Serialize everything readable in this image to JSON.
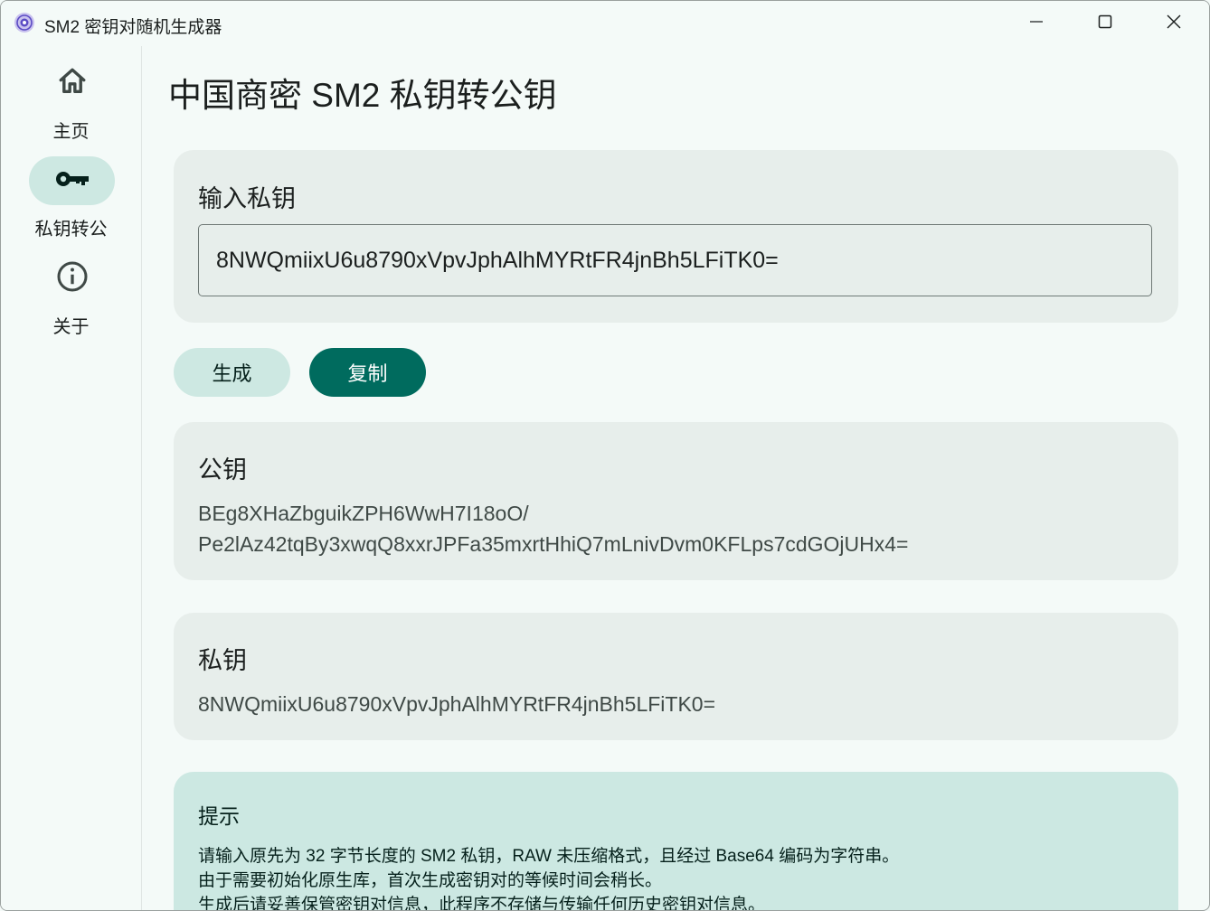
{
  "window": {
    "title": "SM2 密钥对随机生成器",
    "icons": {
      "app": "app-logo-icon",
      "minimize": "minimize-icon",
      "maximize": "maximize-icon",
      "close": "close-icon"
    }
  },
  "sidebar": {
    "items": [
      {
        "label": "主页",
        "icon": "home-icon",
        "active": false
      },
      {
        "label": "私钥转公",
        "icon": "key-icon",
        "active": true
      },
      {
        "label": "关于",
        "icon": "info-icon",
        "active": false
      }
    ]
  },
  "page": {
    "title": "中国商密 SM2 私钥转公钥"
  },
  "input_card": {
    "title": "输入私钥",
    "value": "8NWQmiixU6u8790xVpvJphAlhMYRtFR4jnBh5LFiTK0="
  },
  "actions": {
    "generate_label": "生成",
    "copy_label": "复制"
  },
  "public_key_card": {
    "title": "公钥",
    "value_line1": "BEg8XHaZbguikZPH6WwH7I18oO/",
    "value_line2": "Pe2lAz42tqBy3xwqQ8xxrJPFa35mxrtHhiQ7mLnivDvm0KFLps7cdGOjUHx4="
  },
  "private_key_card": {
    "title": "私钥",
    "value": "8NWQmiixU6u8790xVpvJphAlhMYRtFR4jnBh5LFiTK0="
  },
  "tip_card": {
    "title": "提示",
    "lines": [
      "请输入原先为 32 字节长度的 SM2 私钥，RAW 未压缩格式，且经过 Base64 编码为字符串。",
      "由于需要初始化原生库，首次生成密钥对的等候时间会稍长。",
      "生成后请妥善保管密钥对信息，此程序不存储与传输任何历史密钥对信息。"
    ]
  },
  "colors": {
    "background": "#f4faf8",
    "card": "#e7eeeb",
    "accent": "#006b5e",
    "accent_container": "#cde8e2"
  }
}
